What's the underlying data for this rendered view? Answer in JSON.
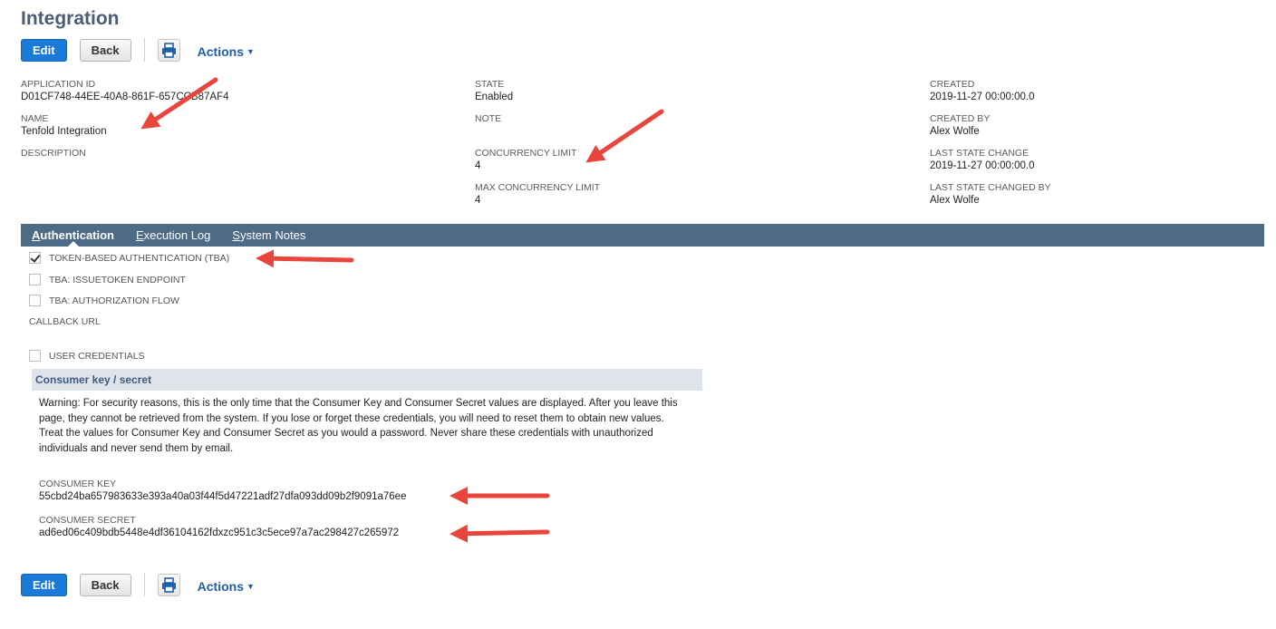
{
  "page": {
    "title": "Integration"
  },
  "toolbar": {
    "edit_label": "Edit",
    "back_label": "Back",
    "actions_label": "Actions"
  },
  "fields": {
    "application_id": {
      "label": "APPLICATION ID",
      "value": "D01CF748-44EE-40A8-861F-657CCB87AF4"
    },
    "name": {
      "label": "NAME",
      "value": "Tenfold Integration"
    },
    "description": {
      "label": "DESCRIPTION",
      "value": ""
    },
    "state": {
      "label": "STATE",
      "value": "Enabled"
    },
    "note": {
      "label": "NOTE",
      "value": ""
    },
    "concurrency_limit": {
      "label": "CONCURRENCY LIMIT",
      "value": "4"
    },
    "max_concurrency_limit": {
      "label": "MAX CONCURRENCY LIMIT",
      "value": "4"
    },
    "created": {
      "label": "CREATED",
      "value": "2019-11-27 00:00:00.0"
    },
    "created_by": {
      "label": "CREATED BY",
      "value": "Alex Wolfe"
    },
    "last_state_change": {
      "label": "LAST STATE CHANGE",
      "value": "2019-11-27 00:00:00.0"
    },
    "last_state_changed_by": {
      "label": "LAST STATE CHANGED BY",
      "value": "Alex Wolfe"
    }
  },
  "subtabs": [
    {
      "first": "A",
      "rest": "uthentication",
      "active": true
    },
    {
      "first": "E",
      "rest": "xecution Log",
      "active": false
    },
    {
      "first": "S",
      "rest": "ystem Notes",
      "active": false
    }
  ],
  "auth": {
    "tba": {
      "label": "TOKEN-BASED AUTHENTICATION (TBA)",
      "checked": true
    },
    "tba_issuetoken": {
      "label": "TBA: ISSUETOKEN ENDPOINT",
      "checked": false
    },
    "tba_authflow": {
      "label": "TBA: AUTHORIZATION FLOW",
      "checked": false
    },
    "callback_url_label": "CALLBACK URL",
    "user_credentials": {
      "label": "USER CREDENTIALS",
      "checked": false
    }
  },
  "consumer": {
    "header": "Consumer key / secret",
    "warning_1": "Warning: For security reasons, this is the only time that the Consumer Key and Consumer Secret values are displayed. After you leave this page, they cannot be retrieved from the system. If you lose or forget these credentials, you will need to reset them to obtain new values.",
    "warning_2": "Treat the values for Consumer Key and Consumer Secret as you would a password. Never share these credentials with unauthorized individuals and never send them by email.",
    "key_label": "CONSUMER KEY",
    "key_value": "55cbd24ba657983633e393a40a03f44f5d47221adf27dfa093dd09b2f9091a76ee",
    "secret_label": "CONSUMER SECRET",
    "secret_value": "ad6ed06c409bdb5448e4df36104162fdxzc951c3c5ece97a7ac298427c265972"
  },
  "icons": {
    "print": "printer-icon",
    "actions_caret": "caret-down-icon"
  },
  "colors": {
    "primary_button": "#1a7ad9",
    "title": "#4b5d74",
    "subtab_bar": "#4d6a87",
    "section_header": "#dfe4ea",
    "annotation_arrow": "#e8453c"
  }
}
